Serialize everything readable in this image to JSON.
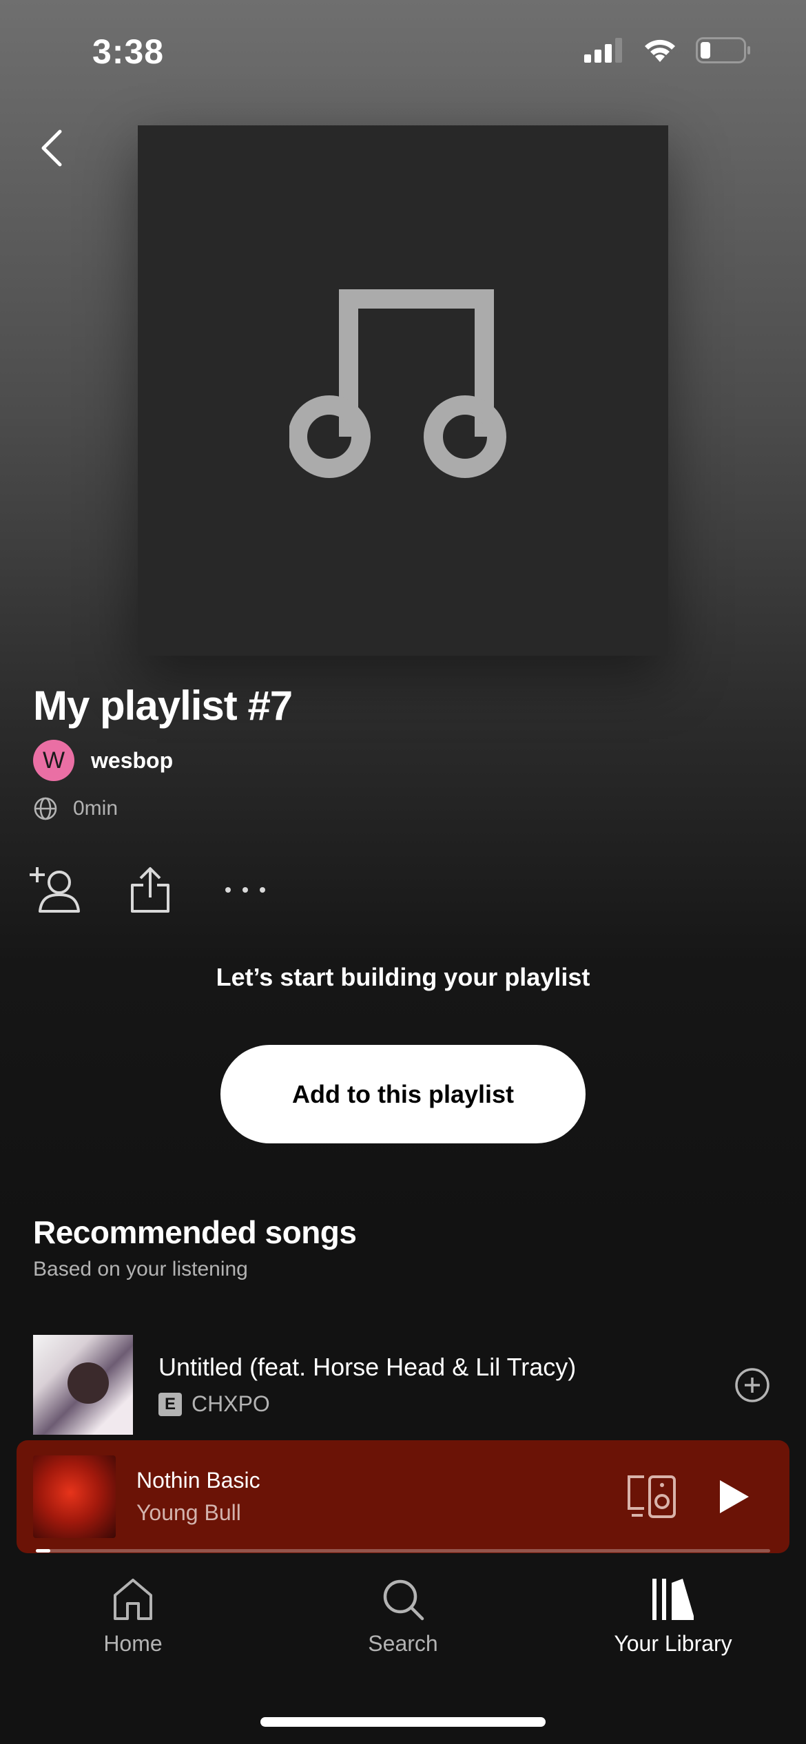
{
  "status_bar": {
    "time": "3:38"
  },
  "playlist": {
    "title": "My playlist #7",
    "owner_initial": "W",
    "owner_name": "wesbop",
    "duration": "0min"
  },
  "empty_state": {
    "heading": "Let’s start building your playlist",
    "add_button": "Add to this playlist"
  },
  "recommended": {
    "title": "Recommended songs",
    "subtitle": "Based on your listening",
    "songs": [
      {
        "title": "Untitled (feat. Horse Head & Lil Tracy)",
        "explicit_badge": "E",
        "artist": "CHXPO"
      }
    ]
  },
  "now_playing": {
    "title": "Nothin Basic",
    "artist": "Young Bull",
    "progress": 0.02
  },
  "nav": {
    "items": [
      {
        "label": "Home",
        "icon": "home-icon"
      },
      {
        "label": "Search",
        "icon": "search-icon"
      },
      {
        "label": "Your Library",
        "icon": "library-icon",
        "active": true
      }
    ]
  },
  "colors": {
    "mini_player_bg": "#6b1306",
    "avatar_bg": "#ea6fa4",
    "background_dark": "#121212"
  }
}
